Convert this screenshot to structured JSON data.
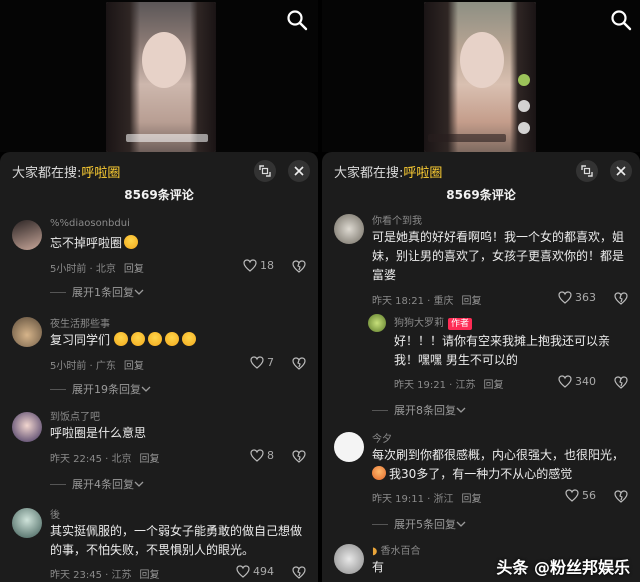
{
  "left": {
    "search_hint": "大家都在搜:",
    "search_keyword": "呼啦圈",
    "comment_count_title": "8569条评论",
    "comments": [
      {
        "user": "%%diaosonbdui",
        "text": "忘不掉呼啦圈",
        "time": "5小时前 · 北京",
        "reply": "回复",
        "likes": "18",
        "expand": "展开1条回复"
      },
      {
        "user": "夜生活那些事",
        "text": "复习同学们",
        "time": "5小时前 · 广东",
        "reply": "回复",
        "likes": "7",
        "expand": "展开19条回复"
      },
      {
        "user": "到饭点了吧",
        "text": "呼啦圈是什么意思",
        "time": "昨天 22:45 · 北京",
        "reply": "回复",
        "likes": "8",
        "expand": "展开4条回复"
      },
      {
        "user": "後",
        "text": "其实挺佩服的，一个弱女子能勇敢的做自己想做的事，不怕失败，不畏惧别人的眼光。",
        "time": "昨天 23:45 · 江苏",
        "reply": "回复",
        "likes": "494"
      }
    ]
  },
  "right": {
    "search_hint": "大家都在搜:",
    "search_keyword": "呼啦圈",
    "comment_count_title": "8569条评论",
    "comments": [
      {
        "user": "你看个到我",
        "text": "可是她真的好好看啊呜！我一个女的都喜欢，姐妹，别让男的喜欢了，女孩子更喜欢你的！都是富婆",
        "time": "昨天 18:21 · 重庆",
        "reply": "回复",
        "likes": "363"
      },
      {
        "user": "狗狗大罗莉",
        "badge": "作者",
        "text": "好！！！请你有空来我摊上抱我还可以亲我！嘿嘿 男生不可以的",
        "time": "昨天 19:21 · 江苏",
        "reply": "回复",
        "likes": "340",
        "expand": "展开8条回复"
      },
      {
        "user": "今夕",
        "text1": "每次刷到你都很感概，内心很强大，也很阳光，",
        "text2": "我30多了，有一种力不从心的感觉",
        "time": "昨天 19:11 · 浙江",
        "reply": "回复",
        "likes": "56",
        "expand": "展开5条回复"
      },
      {
        "user": "香水百合",
        "text": "有"
      }
    ]
  },
  "watermark": "头条 @粉丝邦娱乐",
  "colors": {
    "keyword": "#ffcf33",
    "author_badge": "#fe2c55",
    "sheet_bg": "#1c1c1c"
  }
}
